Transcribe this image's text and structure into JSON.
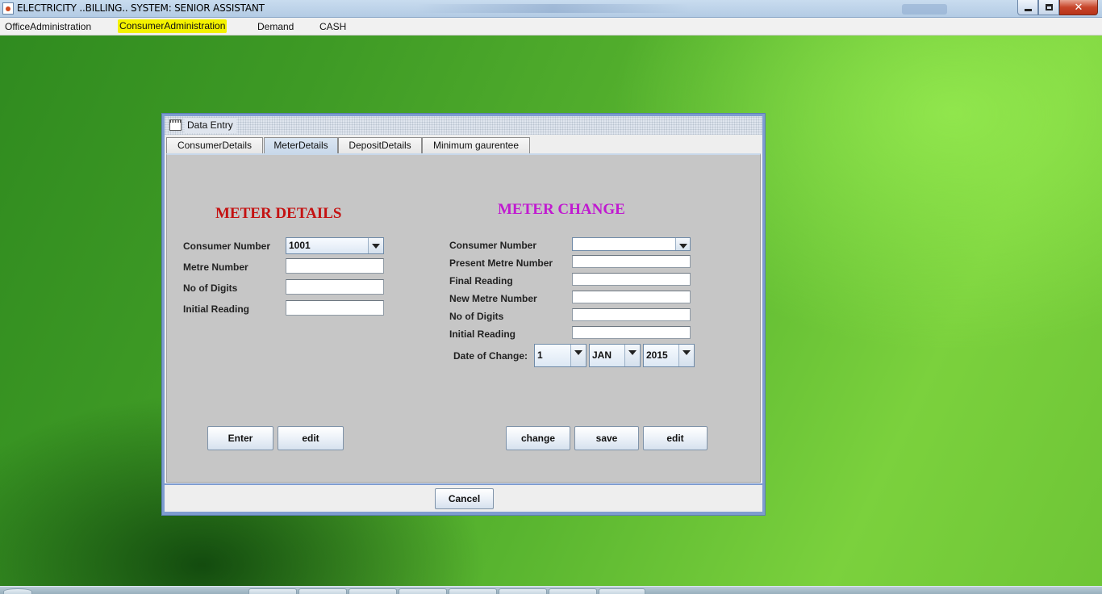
{
  "window": {
    "title": "ELECTRICITY ..BILLING.. SYSTEM: SENIOR ASSISTANT",
    "close_glyph": "✕"
  },
  "menubar": {
    "items": [
      "OfficeAdministration",
      "ConsumerAdministration",
      "Demand",
      "CASH"
    ],
    "highlighted": "ConsumerAdministration",
    "highlight_color": "#f4f200"
  },
  "dialog": {
    "title": "Data Entry",
    "tabs": [
      "ConsumerDetails",
      "MeterDetails",
      "DepositDetails",
      "Minimum gaurentee"
    ],
    "active_tab": "MeterDetails",
    "cancel_label": "Cancel"
  },
  "meter_details": {
    "heading": "METER DETAILS",
    "heading_color": "#c41212",
    "labels": {
      "consumer_number": "Consumer Number",
      "metre_number": "Metre Number",
      "no_of_digits": "No of Digits",
      "initial_reading": "Initial Reading"
    },
    "consumer_number_value": "1001",
    "buttons": {
      "enter": "Enter",
      "edit": "edit"
    }
  },
  "meter_change": {
    "heading": "METER CHANGE",
    "heading_color": "#c01ad0",
    "labels": {
      "consumer_number": "Consumer Number",
      "present_metre_number": "Present Metre Number",
      "final_reading": "Final Reading",
      "new_metre_number": "New Metre Number",
      "no_of_digits": "No of Digits",
      "initial_reading": "Initial Reading",
      "date_of_change": "Date of Change:"
    },
    "consumer_number_value": "",
    "date": {
      "day": "1",
      "month": "JAN",
      "year": "2015"
    },
    "buttons": {
      "change": "change",
      "save": "save",
      "edit": "edit"
    }
  }
}
